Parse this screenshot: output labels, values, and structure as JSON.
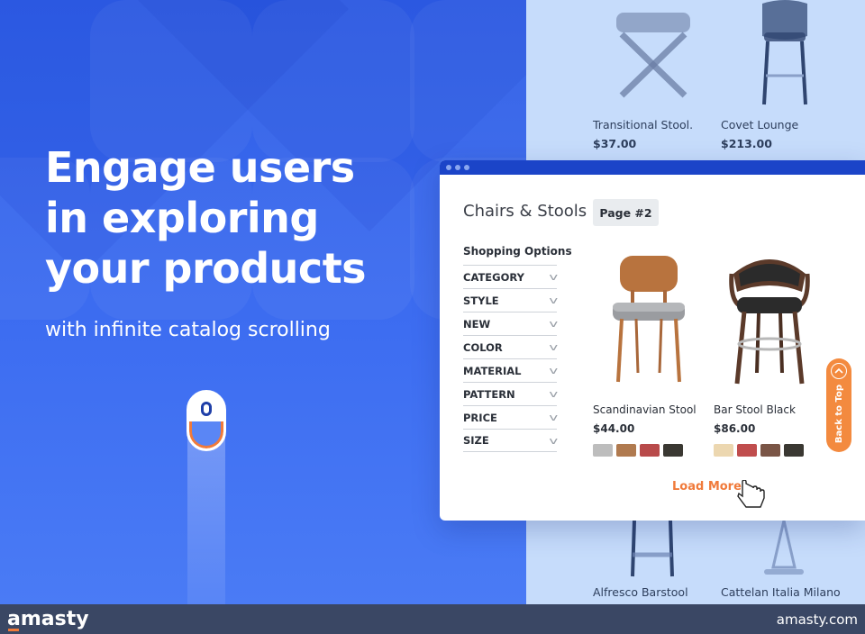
{
  "hero": {
    "headline_line1": "Engage users",
    "headline_line2": "in exploring",
    "headline_line3": "your products",
    "subline": "with infinite catalog scrolling"
  },
  "backdrop_items": [
    {
      "name": "Transitional Stool.",
      "price": "$37.00"
    },
    {
      "name": "Covet Lounge",
      "price": "$213.00"
    },
    {
      "name": "Alfresco Barstool"
    },
    {
      "name": "Cattelan Italia Milano"
    }
  ],
  "window": {
    "title": "Chairs & Stools",
    "page_badge": "Page #2",
    "shopping_options": "Shopping Options",
    "filters": [
      "CATEGORY",
      "STYLE",
      "NEW",
      "COLOR",
      "MATERIAL",
      "PATTERN",
      "PRICE",
      "SIZE"
    ],
    "products": [
      {
        "name": "Scandinavian Stool",
        "price": "$44.00",
        "swatches": [
          "#bdbdbd",
          "#b07a4f",
          "#b84a4a",
          "#3a3832"
        ]
      },
      {
        "name": "Bar Stool Black",
        "price": "$86.00",
        "swatches": [
          "#ecd7b0",
          "#c04d4d",
          "#7a5546",
          "#3a3832"
        ]
      }
    ],
    "load_more": "Load More",
    "back_to_top": "Back to Top"
  },
  "footer": {
    "logo": "amasty",
    "site": "amasty.com"
  },
  "colors": {
    "hero_blue": "#3d6df1",
    "accent_orange": "#f07a3a",
    "window_titlebar": "#1b44c8",
    "footer": "#3a4764"
  }
}
